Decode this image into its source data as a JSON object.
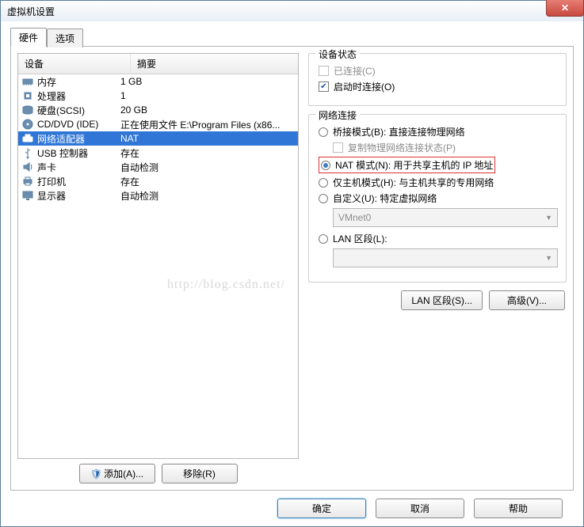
{
  "window": {
    "title": "虚拟机设置"
  },
  "tabs": {
    "hardware": "硬件",
    "options": "选项"
  },
  "hw_table": {
    "col_device": "设备",
    "col_summary": "摘要",
    "rows": [
      {
        "icon": "memory-icon",
        "name": "内存",
        "summary": "1 GB"
      },
      {
        "icon": "cpu-icon",
        "name": "处理器",
        "summary": "1"
      },
      {
        "icon": "disk-icon",
        "name": "硬盘(SCSI)",
        "summary": "20 GB"
      },
      {
        "icon": "cd-icon",
        "name": "CD/DVD (IDE)",
        "summary": "正在使用文件 E:\\Program Files (x86..."
      },
      {
        "icon": "net-icon",
        "name": "网络适配器",
        "summary": "NAT"
      },
      {
        "icon": "usb-icon",
        "name": "USB 控制器",
        "summary": "存在"
      },
      {
        "icon": "sound-icon",
        "name": "声卡",
        "summary": "自动检测"
      },
      {
        "icon": "printer-icon",
        "name": "打印机",
        "summary": "存在"
      },
      {
        "icon": "display-icon",
        "name": "显示器",
        "summary": "自动检测"
      }
    ]
  },
  "status_group": {
    "title": "设备状态",
    "connected": "已连接(C)",
    "connect_on_start": "启动时连接(O)"
  },
  "net_group": {
    "title": "网络连接",
    "bridged": "桥接模式(B): 直接连接物理网络",
    "replicate": "复制物理网络连接状态(P)",
    "nat": "NAT 模式(N): 用于共享主机的 IP 地址",
    "hostonly": "仅主机模式(H): 与主机共享的专用网络",
    "custom": "自定义(U): 特定虚拟网络",
    "custom_value": "VMnet0",
    "lan": "LAN 区段(L):",
    "lan_value": ""
  },
  "buttons": {
    "add": "添加(A)...",
    "remove": "移除(R)",
    "lan_segments": "LAN 区段(S)...",
    "advanced": "高级(V)...",
    "ok": "确定",
    "cancel": "取消",
    "help": "帮助"
  },
  "watermark": "http://blog.csdn.net/"
}
